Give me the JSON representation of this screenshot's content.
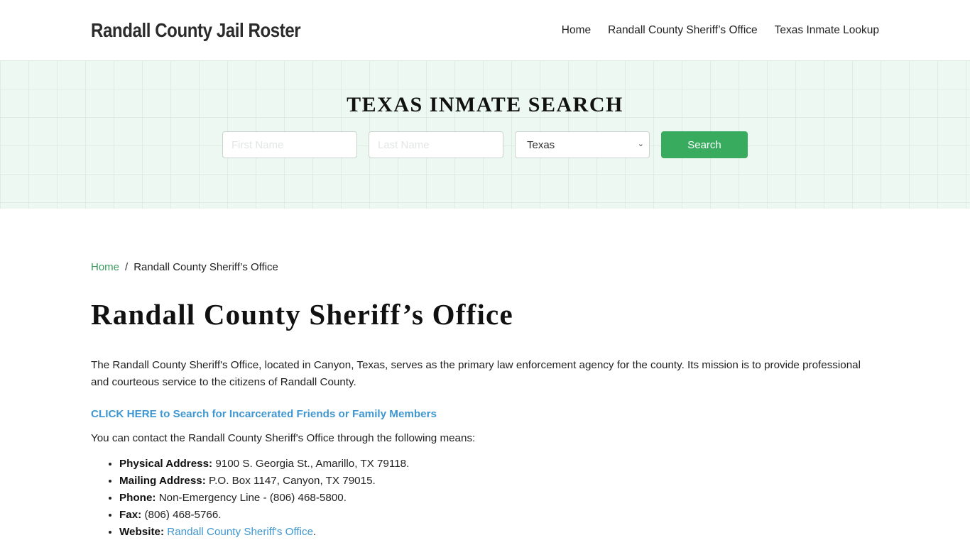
{
  "header": {
    "brand": "Randall County Jail Roster",
    "nav": [
      {
        "label": "Home"
      },
      {
        "label": "Randall County Sheriff’s Office"
      },
      {
        "label": "Texas Inmate Lookup"
      }
    ]
  },
  "hero": {
    "title": "TEXAS INMATE SEARCH",
    "first_name": {
      "value": "",
      "placeholder": "First Name"
    },
    "last_name": {
      "value": "",
      "placeholder": "Last Name"
    },
    "state_select": {
      "selected": "Texas"
    },
    "search_button": "Search"
  },
  "breadcrumb": {
    "home": "Home",
    "separator": "/",
    "current": "Randall County Sheriff’s Office"
  },
  "main": {
    "title": "Randall County Sheriff’s Office",
    "intro": "The Randall County Sheriff's Office, located in Canyon, Texas, serves as the primary law enforcement agency for the county. Its mission is to provide professional and courteous service to the citizens of Randall County.",
    "cta_link": "CLICK HERE to Search for Incarcerated Friends or Family Members",
    "contact_intro": "You can contact the Randall County Sheriff's Office through the following means:",
    "contacts": [
      {
        "label": "Physical Address:",
        "value": " 9100 S. Georgia St., Amarillo, TX 79118."
      },
      {
        "label": "Mailing Address:",
        "value": " P.O. Box 1147, Canyon, TX 79015."
      },
      {
        "label": "Phone:",
        "value": " Non-Emergency Line - (806) 468-5800."
      },
      {
        "label": "Fax:",
        "value": " (806) 468-5766."
      },
      {
        "label": "Website:",
        "link": "Randall County Sheriff's Office",
        "suffix": "."
      }
    ]
  },
  "colors": {
    "accent_green": "#38ab5f",
    "breadcrumb_green": "#3c9a5f",
    "link_blue": "#3e97d1",
    "hero_bg": "#ecf8f1"
  }
}
